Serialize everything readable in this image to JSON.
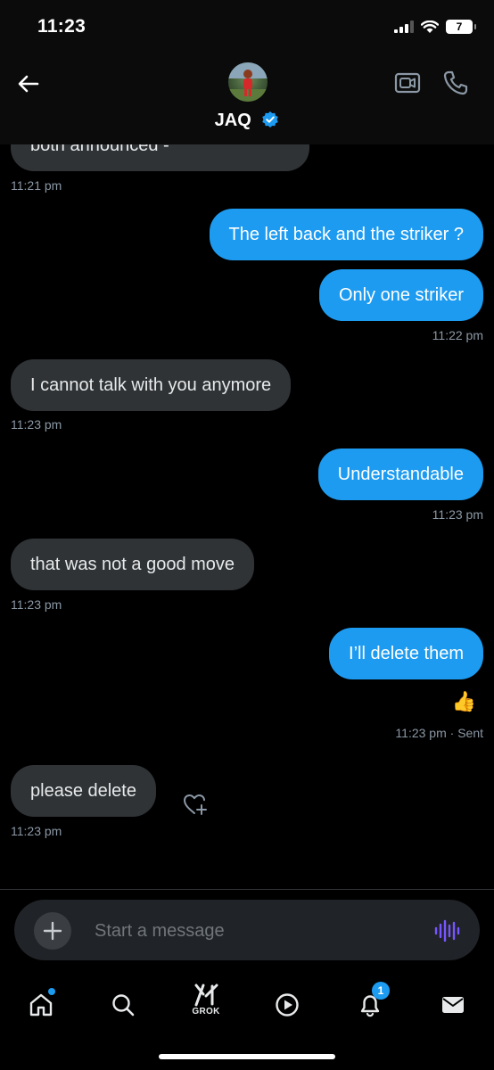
{
  "status_bar": {
    "time": "11:23",
    "battery": "7"
  },
  "header": {
    "contact_name": "JAQ"
  },
  "messages": [
    {
      "text": "both announced -",
      "time": "11:21 pm"
    },
    {
      "text": "The left back and the striker ?"
    },
    {
      "text": "Only one striker",
      "time": "11:22 pm"
    },
    {
      "text": "I cannot talk with you anymore",
      "time": "11:23 pm"
    },
    {
      "text": "Understandable",
      "time": "11:23 pm"
    },
    {
      "text": "that was not a good move",
      "time": "11:23 pm"
    },
    {
      "text": "I’ll delete them",
      "reaction": "👍",
      "time": "11:23 pm",
      "status": "· Sent"
    },
    {
      "text": "please delete",
      "time": "11:23 pm"
    }
  ],
  "composer": {
    "placeholder": "Start a message"
  },
  "nav": {
    "grok_label": "GROK",
    "notifications_badge": "1"
  },
  "colors": {
    "accent": "#1d9bf0",
    "incoming_bubble": "#2f3336",
    "voice": "#7856ff"
  }
}
